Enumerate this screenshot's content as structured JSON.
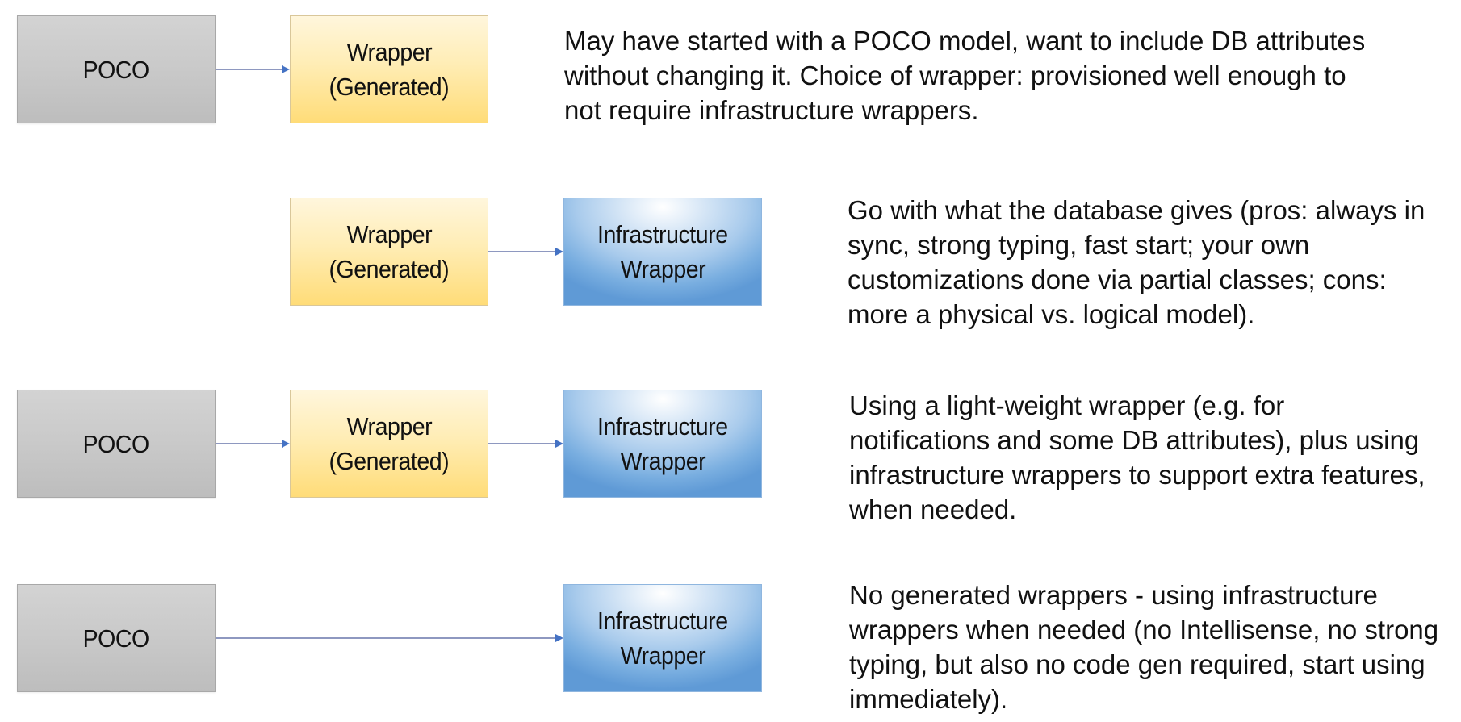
{
  "diagram": {
    "title": "",
    "node_types": {
      "poco": {
        "label": [
          "POCO"
        ],
        "fill": "#c9c9c9"
      },
      "wrapper": {
        "label": [
          "Wrapper",
          "(Generated)"
        ],
        "fill": "#ffe699"
      },
      "infra": {
        "label": [
          "Infrastructure",
          "Wrapper"
        ],
        "fill": "#79aee0"
      }
    },
    "edge_color": "#4472c4",
    "rows": [
      {
        "nodes": {
          "poco": {
            "label": [
              "POCO"
            ]
          },
          "wrapper": {
            "label": [
              "Wrapper",
              "(Generated)"
            ]
          }
        },
        "edges": [
          {
            "from": "poco",
            "to": "wrapper"
          }
        ],
        "description": [
          "May have started with a POCO model, want to include DB attributes",
          "without changing it. Choice of wrapper: provisioned well enough to",
          "not require infrastructure wrappers."
        ]
      },
      {
        "nodes": {
          "wrapper": {
            "label": [
              "Wrapper",
              "(Generated)"
            ]
          },
          "infra": {
            "label": [
              "Infrastructure",
              "Wrapper"
            ]
          }
        },
        "edges": [
          {
            "from": "wrapper",
            "to": "infra"
          }
        ],
        "description": [
          "Go with what the database gives (pros: always in",
          "sync, strong typing, fast start; your own",
          "customizations done via partial classes; cons:",
          "more a physical vs. logical model)."
        ]
      },
      {
        "nodes": {
          "poco": {
            "label": [
              "POCO"
            ]
          },
          "wrapper": {
            "label": [
              "Wrapper",
              "(Generated)"
            ]
          },
          "infra": {
            "label": [
              "Infrastructure",
              "Wrapper"
            ]
          }
        },
        "edges": [
          {
            "from": "poco",
            "to": "wrapper"
          },
          {
            "from": "wrapper",
            "to": "infra"
          }
        ],
        "description": [
          "Using a light-weight wrapper (e.g. for",
          "notifications and some DB attributes), plus using",
          "infrastructure wrappers to support extra features,",
          "when needed."
        ]
      },
      {
        "nodes": {
          "poco": {
            "label": [
              "POCO"
            ]
          },
          "infra": {
            "label": [
              "Infrastructure",
              "Wrapper"
            ]
          }
        },
        "edges": [
          {
            "from": "poco",
            "to": "infra"
          }
        ],
        "description": [
          "No generated wrappers - using infrastructure",
          "wrappers when needed (no Intellisense, no strong",
          "typing, but also no code gen required, start using",
          "immediately)."
        ]
      }
    ]
  }
}
